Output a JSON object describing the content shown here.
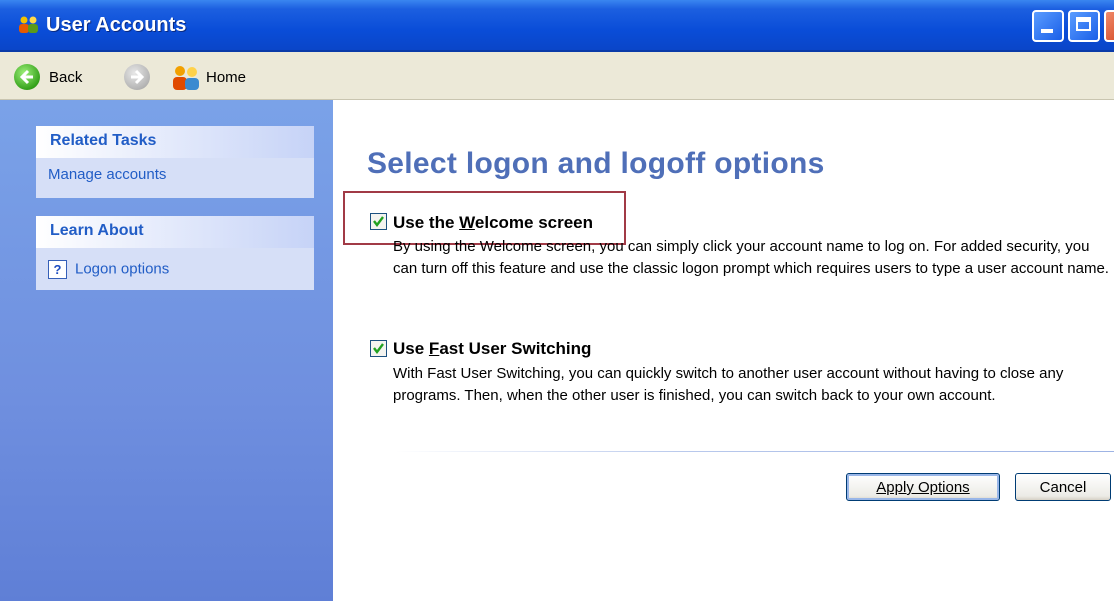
{
  "window": {
    "title": "User Accounts"
  },
  "toolbar": {
    "back_label": "Back",
    "home_label": "Home"
  },
  "sidebar": {
    "related_tasks": {
      "heading": "Related Tasks",
      "items": [
        "Manage accounts"
      ]
    },
    "learn_about": {
      "heading": "Learn About",
      "items": [
        "Logon options"
      ]
    }
  },
  "main": {
    "title": "Select logon and logoff options",
    "options": [
      {
        "label_pre": "Use the ",
        "label_accel": "W",
        "label_post": "elcome screen",
        "checked": true,
        "description": "By using the Welcome screen, you can simply click your account name to log on. For added security, you can turn off this feature and use the classic logon prompt which requires users to type a user account name."
      },
      {
        "label_pre": "Use ",
        "label_accel": "F",
        "label_post": "ast User Switching",
        "checked": true,
        "description": "With Fast User Switching, you can quickly switch to another user account without having to close any programs. Then, when the other user is finished, you can switch back to your own account."
      }
    ],
    "apply_label": "Apply Options",
    "cancel_label": "Cancel"
  },
  "colors": {
    "accent": "#215dc6",
    "title_blue": "#4f6fb8",
    "highlight": "#a13a46"
  }
}
